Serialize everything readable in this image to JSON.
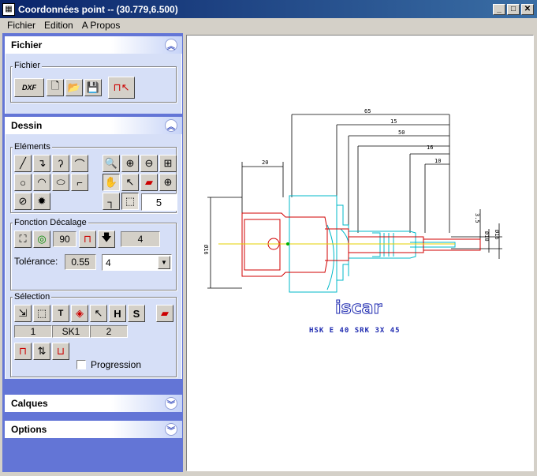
{
  "window": {
    "title": "Coordonnées point -- (30.779,6.500)",
    "minimize": "_",
    "maximize": "□",
    "close": "✕"
  },
  "menu": [
    "Fichier",
    "Edition",
    "A Propos"
  ],
  "sections": {
    "fichier": {
      "label": "Fichier",
      "group": "Fichier",
      "dxf_label": "DXF"
    },
    "dessin": {
      "label": "Dessin",
      "elements_group": "Eléments",
      "snap_value": "5",
      "offset_group": "Fonction Décalage",
      "angle_value": "90",
      "offset_value": "4",
      "tolerance_label": "Tolérance:",
      "tolerance_value": "0.55",
      "tolerance_select": "4",
      "selection_group": "Sélection",
      "selection_fields": [
        "1",
        "SK1",
        "2"
      ],
      "progression_label": "Progression"
    },
    "calques": {
      "label": "Calques"
    },
    "options": {
      "label": "Options"
    }
  },
  "drawing": {
    "dims_top": [
      "65",
      "15",
      "50",
      "16",
      "10"
    ],
    "dim_left": "20",
    "dim_vertical": "Ø16",
    "dim_right": [
      "3.5",
      "Ø10",
      "Ø16"
    ],
    "logo": "iscar",
    "caption": "HSK E 40 SRK 3X 45"
  },
  "colors": {
    "sidebar": "#6375d6",
    "panel": "#d6dff7",
    "titlebar": "#0a246a"
  }
}
